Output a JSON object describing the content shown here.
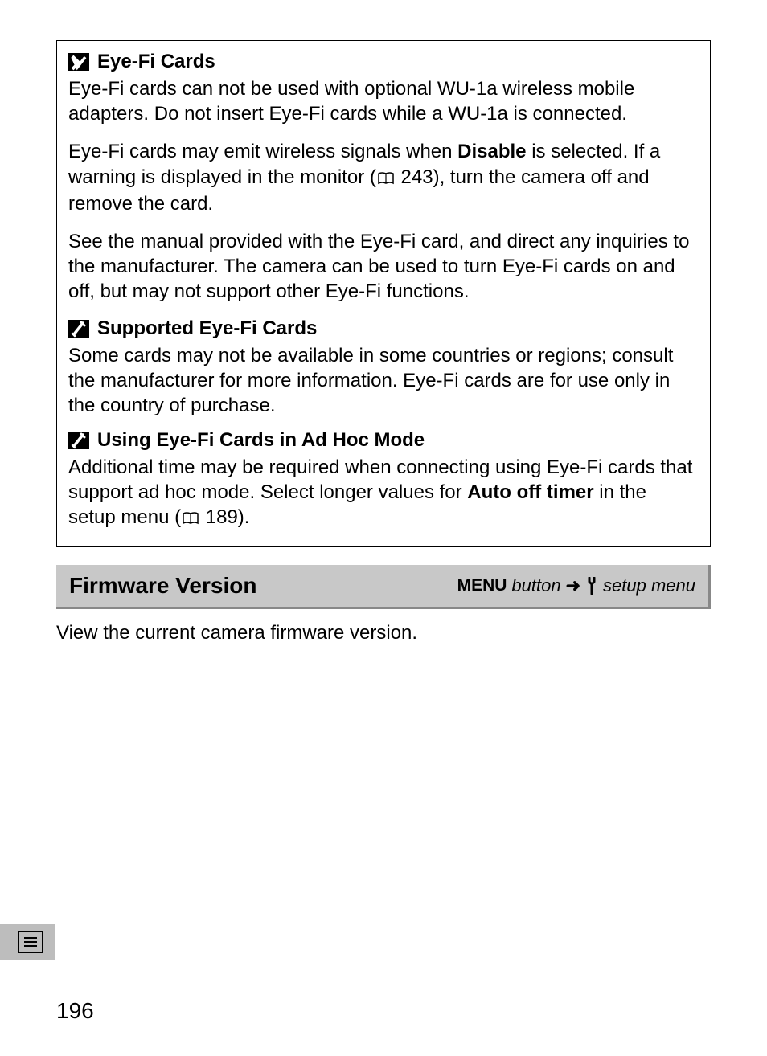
{
  "box": {
    "s1": {
      "title": "Eye-Fi Cards",
      "p1": "Eye-Fi cards can not be used with optional WU-1a wireless mobile adapters.  Do not insert Eye-Fi cards while a WU-1a is connected.",
      "p2a": "Eye-Fi cards may emit wireless signals when ",
      "p2b": "Disable",
      "p2c": " is selected.  If a warning is displayed in the monitor (",
      "p2_ref": "243",
      "p2d": "), turn the camera off and remove the card.",
      "p3": "See the manual provided with the Eye-Fi card, and direct any inquiries to the manufacturer.  The camera can be used to turn Eye-Fi cards on and off, but may not support other Eye-Fi functions."
    },
    "s2": {
      "title": "Supported Eye-Fi Cards",
      "p1": "Some cards may not be available in some countries or regions; consult the manufacturer for more information.  Eye-Fi cards are for use only in the country of purchase."
    },
    "s3": {
      "title": "Using Eye-Fi Cards in Ad Hoc Mode",
      "p1a": "Additional time may be required when connecting using Eye-Fi cards that support ad hoc mode.  Select longer values for ",
      "p1b": "Auto off timer",
      "p1c": " in the setup menu (",
      "p1_ref": "189",
      "p1d": ")."
    }
  },
  "headerbar": {
    "title": "Firmware Version",
    "menu": "MENU",
    "button": "button",
    "setup": "setup menu"
  },
  "firmware_desc": "View the current camera firmware version.",
  "page_number": "196"
}
